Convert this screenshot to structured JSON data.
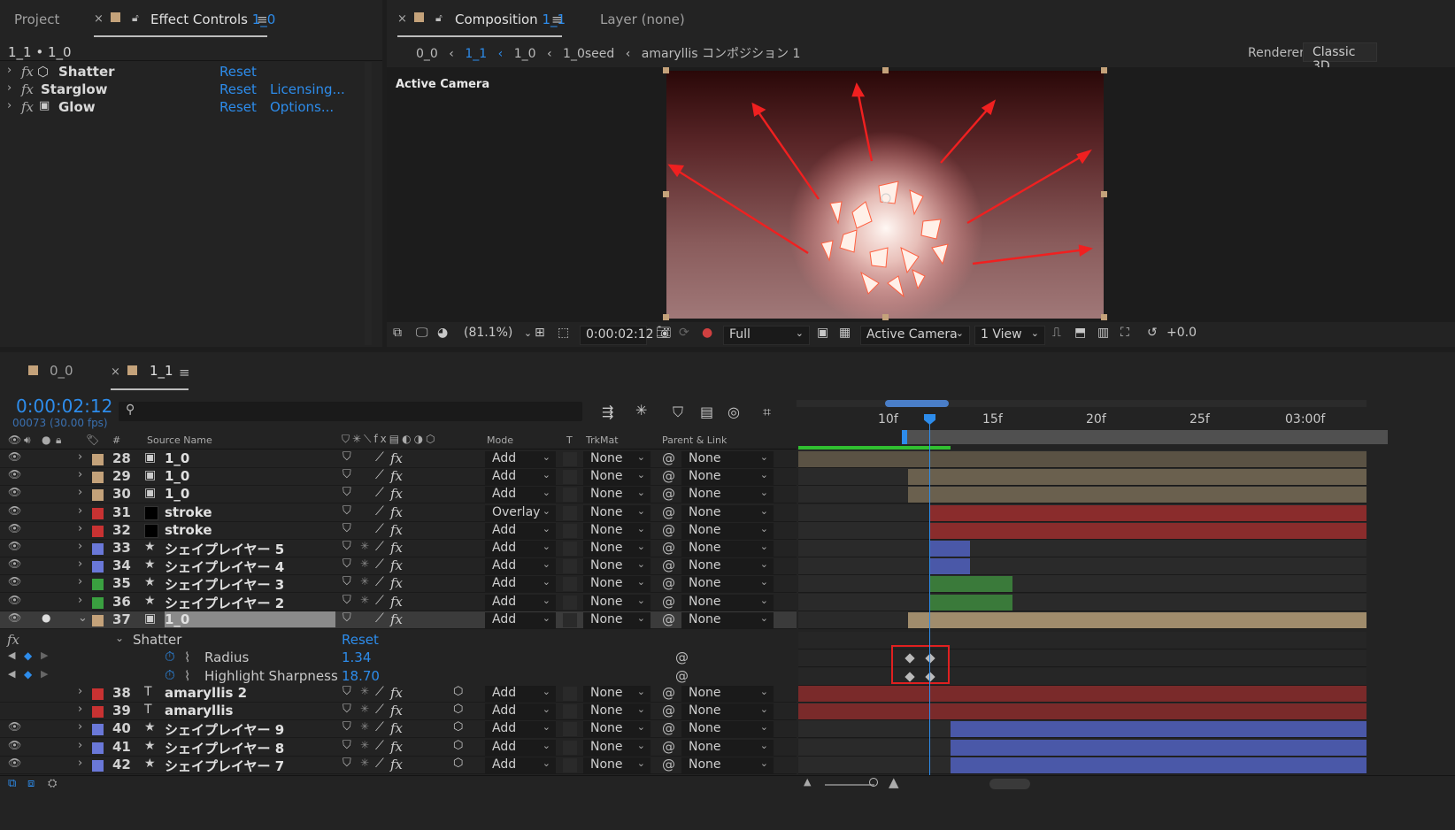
{
  "tabs_top_left": {
    "project": "Project",
    "effect_controls": "Effect Controls",
    "effect_controls_target": "1_0"
  },
  "effect_controls": {
    "breadcrumb": "1_1 • 1_0",
    "effects": [
      {
        "name": "Shatter",
        "reset": "Reset",
        "extra": ""
      },
      {
        "name": "Starglow",
        "reset": "Reset",
        "extra": "Licensing..."
      },
      {
        "name": "Glow",
        "reset": "Reset",
        "extra": "Options..."
      }
    ]
  },
  "viewer": {
    "composition_tab": "Composition",
    "composition_name": "1_1",
    "layer_tab": "Layer  (none)",
    "flow": [
      "0_0",
      "1_1",
      "1_0",
      "1_0seed",
      "amaryllis コンポジション 1"
    ],
    "renderer_label": "Renderer:",
    "renderer_value": "Classic 3D",
    "active_camera_label": "Active Camera",
    "toolbar": {
      "zoom": "(81.1%)",
      "timecode": "0:00:02:12",
      "resolution": "Full",
      "camera": "Active Camera",
      "views": "1 View",
      "exposure": "+0.0"
    }
  },
  "timeline": {
    "tabs": [
      {
        "name": "0_0"
      },
      {
        "name": "1_1"
      }
    ],
    "timecode": "0:00:02:12",
    "frames": "00073 (30.00 fps)",
    "columns": {
      "num": "#",
      "source": "Source Name",
      "mode": "Mode",
      "t": "T",
      "trkmat": "TrkMat",
      "parent": "Parent & Link"
    },
    "ruler": [
      "10f",
      "15f",
      "20f",
      "25f",
      "03:00f"
    ],
    "layers": [
      {
        "num": "28",
        "name": "1_0",
        "mode": "Add",
        "trk": "None",
        "parent": "None",
        "label": "#c4a27a",
        "type": "comp"
      },
      {
        "num": "29",
        "name": "1_0",
        "mode": "Add",
        "trk": "None",
        "parent": "None",
        "label": "#c4a27a",
        "type": "comp"
      },
      {
        "num": "30",
        "name": "1_0",
        "mode": "Add",
        "trk": "None",
        "parent": "None",
        "label": "#c4a27a",
        "type": "comp"
      },
      {
        "num": "31",
        "name": "stroke",
        "mode": "Overlay",
        "trk": "None",
        "parent": "None",
        "label": "#c83232",
        "type": "solid"
      },
      {
        "num": "32",
        "name": "stroke",
        "mode": "Add",
        "trk": "None",
        "parent": "None",
        "label": "#c83232",
        "type": "solid"
      },
      {
        "num": "33",
        "name": "シェイプレイヤー 5",
        "mode": "Add",
        "trk": "None",
        "parent": "None",
        "label": "#6a78d8",
        "type": "shape"
      },
      {
        "num": "34",
        "name": "シェイプレイヤー 4",
        "mode": "Add",
        "trk": "None",
        "parent": "None",
        "label": "#6a78d8",
        "type": "shape"
      },
      {
        "num": "35",
        "name": "シェイプレイヤー 3",
        "mode": "Add",
        "trk": "None",
        "parent": "None",
        "label": "#3aa040",
        "type": "shape"
      },
      {
        "num": "36",
        "name": "シェイプレイヤー 2",
        "mode": "Add",
        "trk": "None",
        "parent": "None",
        "label": "#3aa040",
        "type": "shape"
      },
      {
        "num": "37",
        "name": "1_0",
        "mode": "Add",
        "trk": "None",
        "parent": "None",
        "label": "#c4a27a",
        "type": "comp"
      }
    ],
    "effect_group": {
      "name": "Shatter",
      "reset": "Reset"
    },
    "properties": [
      {
        "name": "Radius",
        "value": "1.34"
      },
      {
        "name": "Highlight Sharpness",
        "value": "18.70"
      }
    ],
    "layers_after": [
      {
        "num": "38",
        "name": "amaryllis 2",
        "mode": "Add",
        "trk": "None",
        "parent": "None",
        "label": "#c83232",
        "type": "text"
      },
      {
        "num": "39",
        "name": "amaryllis",
        "mode": "Add",
        "trk": "None",
        "parent": "None",
        "label": "#c83232",
        "type": "text"
      },
      {
        "num": "40",
        "name": "シェイプレイヤー 9",
        "mode": "Add",
        "trk": "None",
        "parent": "None",
        "label": "#6a78d8",
        "type": "shape"
      },
      {
        "num": "41",
        "name": "シェイプレイヤー 8",
        "mode": "Add",
        "trk": "None",
        "parent": "None",
        "label": "#6a78d8",
        "type": "shape"
      },
      {
        "num": "42",
        "name": "シェイプレイヤー 7",
        "mode": "Add",
        "trk": "None",
        "parent": "None",
        "label": "#6a78d8",
        "type": "shape"
      }
    ]
  }
}
